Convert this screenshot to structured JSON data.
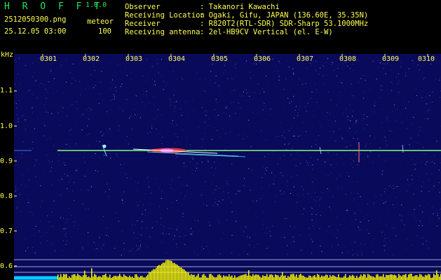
{
  "app": {
    "logo": "H R O F F T",
    "version": "1.0.0"
  },
  "file": {
    "name": "2512050300.png",
    "datetime": "25.12.05 03:00"
  },
  "detection": {
    "label": "meteor",
    "count": "100"
  },
  "info": [
    {
      "key": "Observer",
      "value": ": Takanori Kawachi"
    },
    {
      "key": "Receiving Location",
      "value": ": Ogaki, Gifu, JAPAN (136.60E, 35.35N)"
    },
    {
      "key": "Receiver",
      "value": ": R820T2(RTL-SDR) SDR-Sharp 53.1000MHz"
    },
    {
      "key": "Receiving antenna",
      "value": ": 2el-HB9CV Vertical (el. E-W)"
    }
  ],
  "spectrogram": {
    "y_unit": "kHz",
    "y_ticks": [
      "1.1",
      "1.0",
      "0.9",
      "0.8",
      "0.7",
      "0.6"
    ],
    "x_ticks": [
      "0301",
      "0302",
      "0303",
      "0304",
      "0305",
      "0306",
      "0307",
      "0308",
      "0309",
      "0310"
    ],
    "carrier_khz": 0.93,
    "colors": {
      "background": "#0a0a5a",
      "text": "#ffff55",
      "logo": "#22e85a",
      "carrier": "#7cfc7c",
      "bars": "#ffff00",
      "baseline": "#00ccff"
    }
  }
}
